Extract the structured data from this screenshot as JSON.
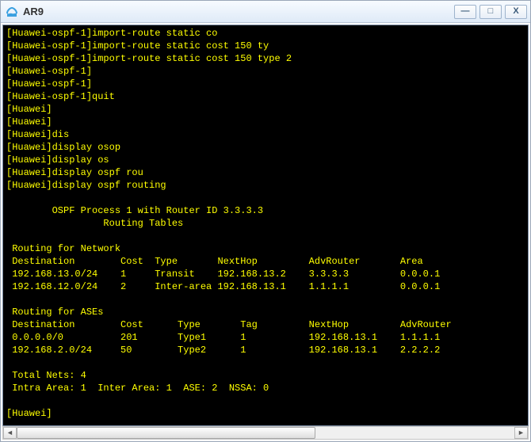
{
  "window": {
    "title": "AR9",
    "buttons": {
      "min": "—",
      "max": "□",
      "close": "X"
    }
  },
  "terminal": {
    "lines": [
      "[Huawei-ospf-1]import-route static co",
      "[Huawei-ospf-1]import-route static cost 150 ty",
      "[Huawei-ospf-1]import-route static cost 150 type 2",
      "[Huawei-ospf-1]",
      "[Huawei-ospf-1]",
      "[Huawei-ospf-1]quit",
      "[Huawei]",
      "[Huawei]",
      "[Huawei]dis",
      "[Huawei]display osop",
      "[Huawei]display os",
      "[Huawei]display ospf rou",
      "[Huawei]display ospf routing",
      "",
      "        OSPF Process 1 with Router ID 3.3.3.3",
      "                 Routing Tables",
      "",
      " Routing for Network",
      " Destination        Cost  Type       NextHop         AdvRouter       Area",
      " 192.168.13.0/24    1     Transit    192.168.13.2    3.3.3.3         0.0.0.1",
      " 192.168.12.0/24    2     Inter-area 192.168.13.1    1.1.1.1         0.0.0.1",
      "",
      " Routing for ASEs",
      " Destination        Cost      Type       Tag         NextHop         AdvRouter",
      " 0.0.0.0/0          201       Type1      1           192.168.13.1    1.1.1.1",
      " 192.168.2.0/24     50        Type2      1           192.168.13.1    2.2.2.2",
      "",
      " Total Nets: 4",
      " Intra Area: 1  Inter Area: 1  ASE: 2  NSSA: 0",
      "",
      "[Huawei]"
    ]
  },
  "scrollbar": {
    "left": "◄",
    "right": "►"
  },
  "chart_data": {
    "type": "table",
    "title": "OSPF Process 1 with Router ID 3.3.3.3 — Routing Tables",
    "router_id": "3.3.3.3",
    "routing_for_network": {
      "columns": [
        "Destination",
        "Cost",
        "Type",
        "NextHop",
        "AdvRouter",
        "Area"
      ],
      "rows": [
        [
          "192.168.13.0/24",
          1,
          "Transit",
          "192.168.13.2",
          "3.3.3.3",
          "0.0.0.1"
        ],
        [
          "192.168.12.0/24",
          2,
          "Inter-area",
          "192.168.13.1",
          "1.1.1.1",
          "0.0.0.1"
        ]
      ]
    },
    "routing_for_ases": {
      "columns": [
        "Destination",
        "Cost",
        "Type",
        "Tag",
        "NextHop",
        "AdvRouter"
      ],
      "rows": [
        [
          "0.0.0.0/0",
          201,
          "Type1",
          1,
          "192.168.13.1",
          "1.1.1.1"
        ],
        [
          "192.168.2.0/24",
          50,
          "Type2",
          1,
          "192.168.13.1",
          "2.2.2.2"
        ]
      ]
    },
    "totals": {
      "Total Nets": 4,
      "Intra Area": 1,
      "Inter Area": 1,
      "ASE": 2,
      "NSSA": 0
    }
  }
}
